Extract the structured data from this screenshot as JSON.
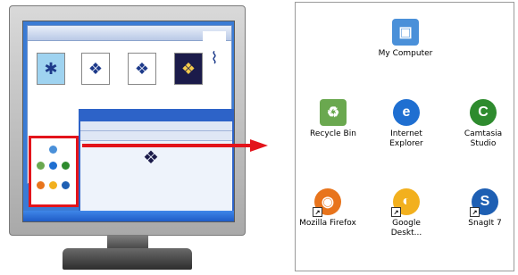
{
  "desktop": {
    "icons": [
      {
        "label": "My Computer",
        "icon": "my-computer-icon",
        "color": "#4a90d9",
        "glyph": "▣"
      },
      {
        "label": "Recycle Bin",
        "icon": "recycle-bin-icon",
        "color": "#6aa84f",
        "glyph": "♻"
      },
      {
        "label": "Internet Explorer",
        "icon": "internet-explorer-icon",
        "color": "#1f6fd1",
        "glyph": "e"
      },
      {
        "label": "Camtasia Studio",
        "icon": "camtasia-studio-icon",
        "color": "#2e8b2e",
        "glyph": "C"
      },
      {
        "label": "Mozilla Firefox",
        "icon": "firefox-icon",
        "color": "#e8741c",
        "glyph": "◉"
      },
      {
        "label": "Google Deskt...",
        "icon": "google-desktop-icon",
        "color": "#f2b01e",
        "glyph": "◐"
      },
      {
        "label": "SnagIt 7",
        "icon": "snagit-icon",
        "color": "#1e5fb3",
        "glyph": "S"
      }
    ]
  },
  "colors": {
    "highlight": "#e3141b",
    "screen": "#3a7bd5"
  }
}
